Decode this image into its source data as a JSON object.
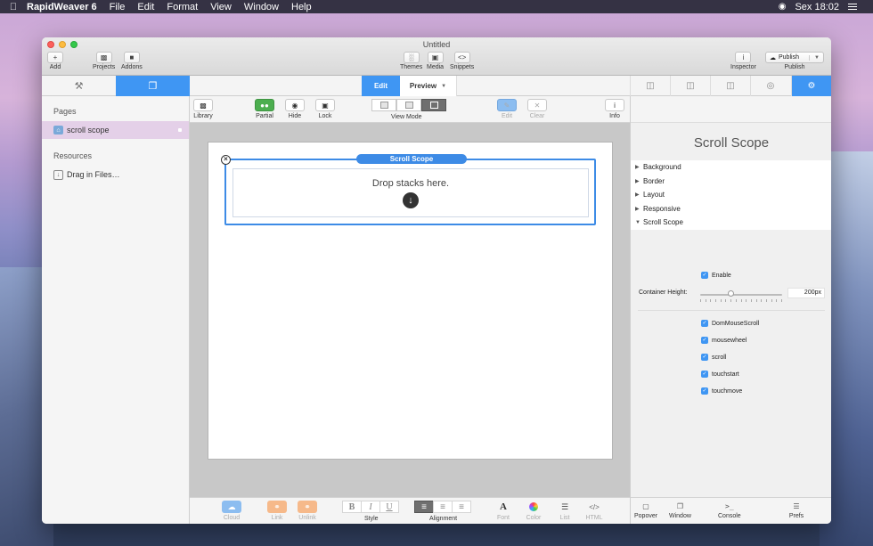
{
  "menubar": {
    "app": "RapidWeaver 6",
    "items": [
      "File",
      "Edit",
      "Format",
      "View",
      "Window",
      "Help"
    ],
    "clock": "Sex 18:02"
  },
  "window": {
    "title": "Untitled"
  },
  "titlebar": {
    "add": "Add",
    "projects": "Projects",
    "addons": "Addons",
    "themes": "Themes",
    "media": "Media",
    "snippets": "Snippets",
    "inspector": "Inspector",
    "publish_button": "Publish",
    "publish_label": "Publish"
  },
  "modes": {
    "edit": "Edit",
    "preview": "Preview"
  },
  "sidebar": {
    "pages_header": "Pages",
    "page": "scroll scope",
    "resources_header": "Resources",
    "drag": "Drag in Files…"
  },
  "toolbar": {
    "library": "Library",
    "partial": "Partial",
    "hide": "Hide",
    "lock": "Lock",
    "view_mode": "View Mode",
    "edit": "Edit",
    "clear": "Clear",
    "info": "Info"
  },
  "canvas": {
    "stack_title": "Scroll Scope",
    "drop_text": "Drop stacks here."
  },
  "bottombar": {
    "cloud": "Cloud",
    "link": "Link",
    "unlink": "Unlink",
    "style": "Style",
    "bold": "B",
    "italic": "I",
    "underline": "U",
    "alignment": "Alignment",
    "font": "Font",
    "color": "Color",
    "list": "List",
    "html": "HTML"
  },
  "inspector": {
    "title": "Scroll Scope",
    "sections": [
      "Background",
      "Border",
      "Layout",
      "Responsive",
      "Scroll Scope"
    ],
    "enable": "Enable",
    "container_height_label": "Container Height:",
    "container_height_value": "200px",
    "container_height_fraction": 0.38,
    "events": [
      "DomMouseScroll",
      "mousewheel",
      "scroll",
      "touchstart",
      "touchmove"
    ],
    "bottom": {
      "popover": "Popover",
      "window": "Window",
      "console": "Console",
      "prefs": "Prefs"
    }
  },
  "colors": {
    "accent": "#3f96f3",
    "partial_green": "#4cae4f",
    "cloud_blue": "#8cbdf0",
    "link_orange": "#f6b98a"
  }
}
